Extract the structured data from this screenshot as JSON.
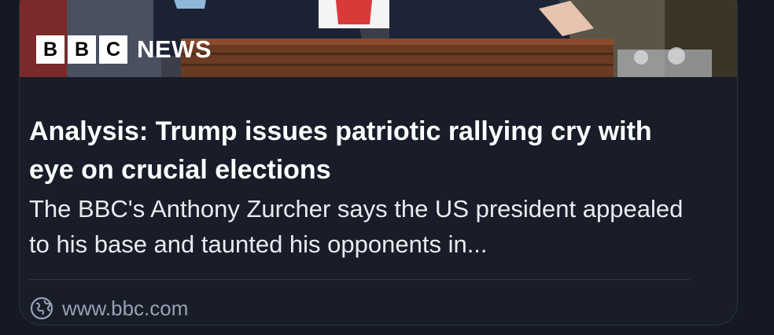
{
  "card": {
    "image": {
      "brand_boxes": [
        "B",
        "B",
        "C"
      ],
      "brand_word": "NEWS",
      "colors": {
        "suit": "#1b2233",
        "tie": "#d83a3a",
        "podium": "#6b3a22",
        "background": "#3a3f4a"
      }
    },
    "headline": "Analysis: Trump issues patriotic rallying cry with eye on crucial elections",
    "description": "The BBC's Anthony Zurcher says the US president appealed to his base and taunted his opponents in...",
    "source": {
      "icon": "globe-icon",
      "url": "www.bbc.com"
    }
  },
  "colors": {
    "page_bg": "#151924",
    "card_border": "#2b3140",
    "headline": "#ffffff",
    "description": "#e9ebf0",
    "muted": "#9aa1b0"
  }
}
